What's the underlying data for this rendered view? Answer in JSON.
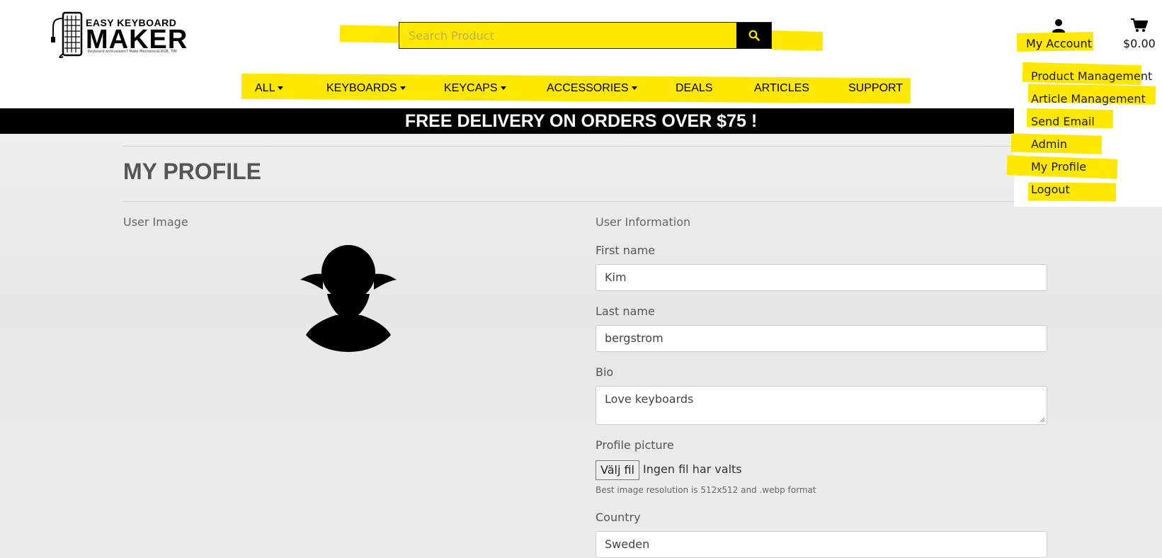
{
  "brand": {
    "top": "EASY KEYBOARD",
    "main": "MAKER",
    "tagline": "Keyboard enthusiasm? Make Mechanical RGB, TIM"
  },
  "search": {
    "placeholder": "Search Product",
    "button_icon": "search-icon"
  },
  "nav": {
    "all": "ALL",
    "keyboards": "KEYBOARDS",
    "keycaps": "KEYCAPS",
    "accessories": "ACCESSORIES",
    "deals": "DEALS",
    "articles": "ARTICLES",
    "support": "SUPPORT"
  },
  "account": {
    "label": "My Account",
    "icon": "user-icon"
  },
  "cart": {
    "amount": "$0.00",
    "icon": "cart-icon"
  },
  "banner": "FREE DELIVERY ON ORDERS OVER $75 !",
  "account_menu": [
    "Product Management",
    "Article Management",
    "Send Email",
    "Admin",
    "My Profile",
    "Logout"
  ],
  "profile": {
    "title": "MY PROFILE",
    "user_image_label": "User Image",
    "user_info_label": "User Information",
    "first_name_label": "First name",
    "first_name": "Kim",
    "last_name_label": "Last name",
    "last_name": "bergstrom",
    "bio_label": "Bio",
    "bio": "Love keyboards",
    "picture_label": "Profile picture",
    "file_button": "Välj fil",
    "file_status": "Ingen fil har valts",
    "picture_hint": "Best image resolution is 512x512 and .webp format",
    "country_label": "Country",
    "country": "Sweden"
  },
  "colors": {
    "highlight": "#ffe800",
    "banner_bg": "#000000",
    "banner_text": "#ffffff"
  }
}
